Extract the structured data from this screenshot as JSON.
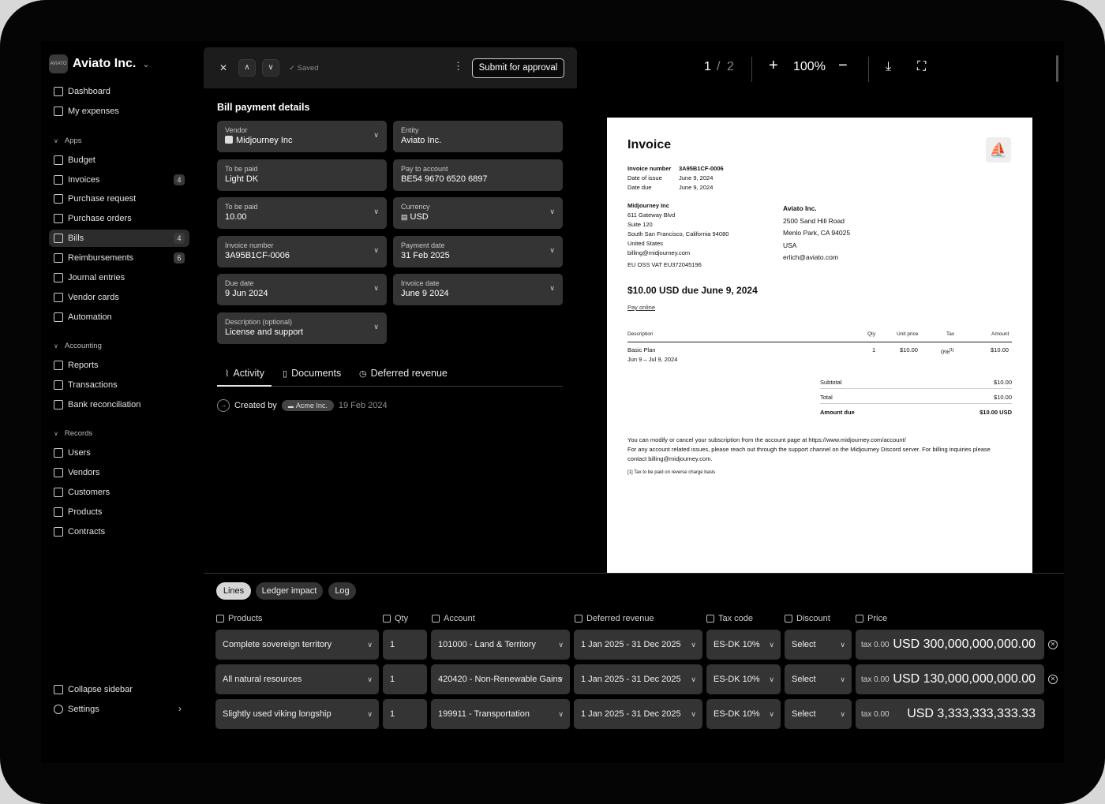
{
  "sidebar": {
    "brand": {
      "logo_text": "AVIATO",
      "name": "Aviato Inc."
    },
    "top_items": [
      {
        "label": "Dashboard"
      },
      {
        "label": "My expenses"
      }
    ],
    "apps_label": "Apps",
    "apps_items": [
      {
        "label": "Budget"
      },
      {
        "label": "Invoices",
        "badge": "4"
      },
      {
        "label": "Purchase request"
      },
      {
        "label": "Purchase orders"
      },
      {
        "label": "Bills",
        "badge": "4"
      },
      {
        "label": "Reimbursements",
        "badge": "6"
      },
      {
        "label": "Journal entries"
      },
      {
        "label": "Vendor cards"
      },
      {
        "label": "Automation"
      }
    ],
    "accounting_label": "Accounting",
    "accounting_items": [
      {
        "label": "Reports"
      },
      {
        "label": "Transactions"
      },
      {
        "label": "Bank reconciliation"
      }
    ],
    "records_label": "Records",
    "records_items": [
      {
        "label": "Users"
      },
      {
        "label": "Vendors"
      },
      {
        "label": "Customers"
      },
      {
        "label": "Products"
      },
      {
        "label": "Contracts"
      }
    ],
    "bottom_items": [
      {
        "label": "Collapse sidebar"
      },
      {
        "label": "Settings"
      }
    ]
  },
  "toolbar": {
    "saved_label": "Saved",
    "submit_label": "Submit for approval"
  },
  "bill": {
    "title": "Bill payment details",
    "fields": {
      "vendor": {
        "label": "Vendor",
        "value": "Midjourney Inc"
      },
      "entity": {
        "label": "Entity",
        "value": "Aviato Inc."
      },
      "to_be_paid_account": {
        "label": "To be paid",
        "value": "Light DK"
      },
      "pay_to_account": {
        "label": "Pay to account",
        "value": "BE54 9670 6520 6897"
      },
      "to_be_paid_amount": {
        "label": "To be paid",
        "value": "10.00"
      },
      "currency": {
        "label": "Currency",
        "value": "USD"
      },
      "invoice_number": {
        "label": "Invoice number",
        "value": "3A95B1CF-0006"
      },
      "payment_date": {
        "label": "Payment date",
        "value": "31 Feb 2025"
      },
      "due_date": {
        "label": "Due date",
        "value": "9 Jun 2024"
      },
      "invoice_date": {
        "label": "Invoice date",
        "value": "June 9 2024"
      },
      "description": {
        "label": "Description (optional)",
        "value": "License and support"
      }
    },
    "tabs": {
      "activity": "Activity",
      "documents": "Documents",
      "deferred": "Deferred revenue"
    },
    "activity": {
      "created_by": "Created by",
      "chip": "Acme Inc.",
      "date": "19 Feb 2024"
    }
  },
  "pdf": {
    "page_current": "1",
    "page_sep": "/",
    "page_total": "2",
    "zoom": "100%"
  },
  "invoice": {
    "title": "Invoice",
    "meta": [
      {
        "k": "Invoice number",
        "v": "3A95B1CF-0006"
      },
      {
        "k": "Date of issue",
        "v": "June 9, 2024"
      },
      {
        "k": "Date due",
        "v": "June 9, 2024"
      }
    ],
    "from": {
      "name": "Midjourney Inc",
      "line1": "611 Gateway Blvd",
      "line2": "Suite 120",
      "line3": "South San Francisco, California 94080",
      "line4": "United States",
      "line5": "billing@midjourney.com",
      "vat": "EU OSS VAT  EU372045196"
    },
    "to": {
      "name": "Aviato Inc.",
      "line1": "2500 Sand Hill Road",
      "line2": "Menlo Park, CA 94025",
      "line3": "USA",
      "line4": "erlich@aviato.com"
    },
    "due_heading": "$10.00 USD due June 9, 2024",
    "pay_online": "Pay online",
    "table_headers": {
      "description": "Description",
      "qty": "Qty",
      "unit_price": "Unit price",
      "tax": "Tax",
      "amount": "Amount"
    },
    "row": {
      "description": "Basic Plan",
      "period": "Jun 9 – Jul 9, 2024",
      "qty": "1",
      "unit_price": "$10.00",
      "tax": "0%",
      "tax_note": "[1]",
      "amount": "$10.00"
    },
    "totals": {
      "subtotal_label": "Subtotal",
      "subtotal": "$10.00",
      "total_label": "Total",
      "total": "$10.00",
      "amount_due_label": "Amount due",
      "amount_due": "$10.00 USD"
    },
    "note1": "You can modify or cancel your subscription from the account page at https://www.midjourney.com/account/",
    "note2": "For any account related issues, please reach out through the support channel on the Midjourney Discord server. For billing inquiries please contact billing@midjourney.com.",
    "footnote": "[1] Tax to be paid on reverse charge basis"
  },
  "lines": {
    "tabs": {
      "lines": "Lines",
      "ledger": "Ledger impact",
      "log": "Log"
    },
    "headers": {
      "products": "Products",
      "qty": "Qty",
      "account": "Account",
      "deferred": "Deferred revenue",
      "tax_code": "Tax code",
      "discount": "Discount",
      "price": "Price"
    },
    "rows": [
      {
        "product": "Complete sovereign territory",
        "qty": "1",
        "account": "101000 - Land & Territory",
        "deferred": "1 Jan 2025 - 31 Dec 2025",
        "tax_code": "ES-DK 10%",
        "discount": "Select",
        "tax": "tax 0.00",
        "price": "USD 300,000,000,000.00"
      },
      {
        "product": "All natural resources",
        "qty": "1",
        "account": "420420 - Non-Renewable Gains",
        "deferred": "1 Jan 2025 - 31 Dec 2025",
        "tax_code": "ES-DK 10%",
        "discount": "Select",
        "tax": "tax 0.00",
        "price": "USD 130,000,000,000.00"
      },
      {
        "product": "Slightly used viking longship",
        "qty": "1",
        "account": "199911 - Transportation",
        "deferred": "1 Jan 2025 - 31 Dec 2025",
        "tax_code": "ES-DK 10%",
        "discount": "Select",
        "tax": "tax 0.00",
        "price": "USD 3,333,333,333.33"
      }
    ]
  }
}
